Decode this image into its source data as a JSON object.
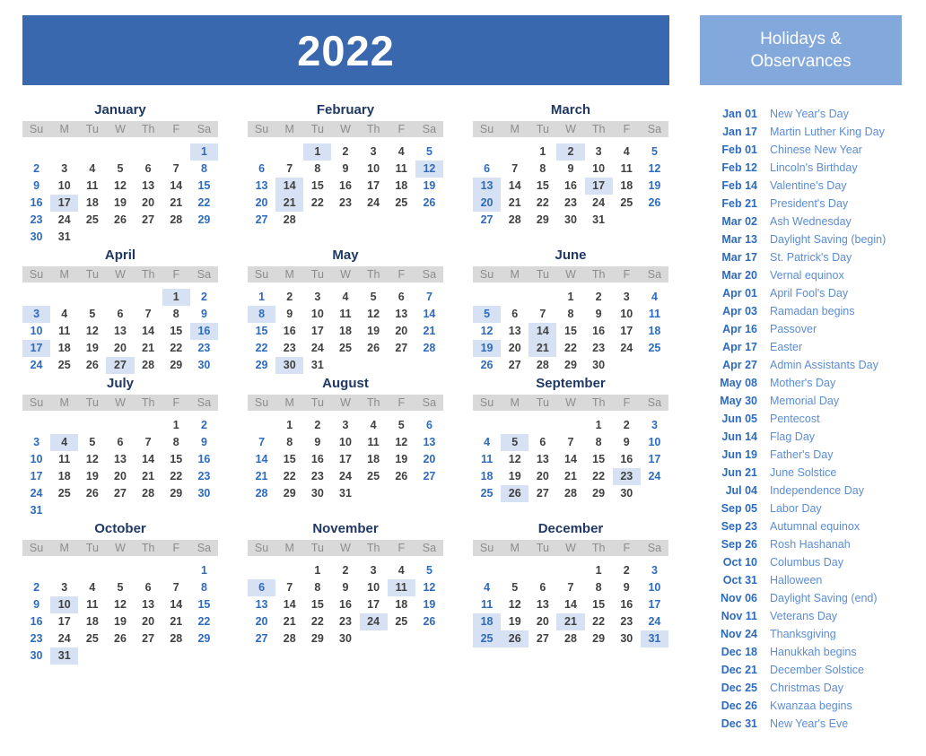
{
  "year_banner": {
    "year": "2022"
  },
  "holidays_panel": {
    "title_line1": "Holidays &",
    "title_line2": "Observances",
    "items": [
      {
        "date": "Jan 01",
        "name": "New Year's Day"
      },
      {
        "date": "Jan 17",
        "name": "Martin Luther King Day"
      },
      {
        "date": "Feb 01",
        "name": "Chinese New Year"
      },
      {
        "date": "Feb 12",
        "name": "Lincoln's Birthday"
      },
      {
        "date": "Feb 14",
        "name": "Valentine's Day"
      },
      {
        "date": "Feb 21",
        "name": "President's Day"
      },
      {
        "date": "Mar 02",
        "name": "Ash Wednesday"
      },
      {
        "date": "Mar 13",
        "name": "Daylight Saving (begin)"
      },
      {
        "date": "Mar 17",
        "name": "St. Patrick's Day"
      },
      {
        "date": "Mar 20",
        "name": "Vernal equinox"
      },
      {
        "date": "Apr 01",
        "name": "April Fool's Day"
      },
      {
        "date": "Apr 03",
        "name": "Ramadan begins"
      },
      {
        "date": "Apr 16",
        "name": "Passover"
      },
      {
        "date": "Apr 17",
        "name": "Easter"
      },
      {
        "date": "Apr 27",
        "name": "Admin Assistants Day"
      },
      {
        "date": "May 08",
        "name": "Mother's Day"
      },
      {
        "date": "May 30",
        "name": "Memorial Day"
      },
      {
        "date": "Jun 05",
        "name": "Pentecost"
      },
      {
        "date": "Jun 14",
        "name": "Flag Day"
      },
      {
        "date": "Jun 19",
        "name": "Father's Day"
      },
      {
        "date": "Jun 21",
        "name": "June Solstice"
      },
      {
        "date": "Jul 04",
        "name": "Independence Day"
      },
      {
        "date": "Sep 05",
        "name": "Labor Day"
      },
      {
        "date": "Sep 23",
        "name": "Autumnal equinox"
      },
      {
        "date": "Sep 26",
        "name": "Rosh Hashanah"
      },
      {
        "date": "Oct 10",
        "name": "Columbus Day"
      },
      {
        "date": "Oct 31",
        "name": "Halloween"
      },
      {
        "date": "Nov 06",
        "name": "Daylight Saving (end)"
      },
      {
        "date": "Nov 11",
        "name": "Veterans Day"
      },
      {
        "date": "Nov 24",
        "name": "Thanksgiving"
      },
      {
        "date": "Dec 18",
        "name": "Hanukkah begins"
      },
      {
        "date": "Dec 21",
        "name": "December Solstice"
      },
      {
        "date": "Dec 25",
        "name": "Christmas Day"
      },
      {
        "date": "Dec 26",
        "name": "Kwanzaa begins"
      },
      {
        "date": "Dec 31",
        "name": "New Year's Eve"
      }
    ]
  },
  "calendar": {
    "weekday_headers": [
      "Su",
      "M",
      "Tu",
      "W",
      "Th",
      "F",
      "Sa"
    ],
    "weekend_columns": [
      0,
      6
    ],
    "months": [
      {
        "name": "January",
        "days": 31,
        "first_weekday": 6,
        "highlights": [
          1,
          17
        ]
      },
      {
        "name": "February",
        "days": 28,
        "first_weekday": 2,
        "highlights": [
          1,
          12,
          14,
          21
        ]
      },
      {
        "name": "March",
        "days": 31,
        "first_weekday": 2,
        "highlights": [
          2,
          13,
          17,
          20
        ]
      },
      {
        "name": "April",
        "days": 30,
        "first_weekday": 5,
        "highlights": [
          1,
          3,
          16,
          17,
          27
        ]
      },
      {
        "name": "May",
        "days": 31,
        "first_weekday": 0,
        "highlights": [
          8,
          30
        ]
      },
      {
        "name": "June",
        "days": 30,
        "first_weekday": 3,
        "highlights": [
          5,
          14,
          19,
          21
        ]
      },
      {
        "name": "July",
        "days": 31,
        "first_weekday": 5,
        "highlights": [
          4
        ]
      },
      {
        "name": "August",
        "days": 31,
        "first_weekday": 1,
        "highlights": []
      },
      {
        "name": "September",
        "days": 30,
        "first_weekday": 4,
        "highlights": [
          5,
          23,
          26
        ]
      },
      {
        "name": "October",
        "days": 31,
        "first_weekday": 6,
        "highlights": [
          10,
          31
        ]
      },
      {
        "name": "November",
        "days": 30,
        "first_weekday": 2,
        "highlights": [
          6,
          11,
          24
        ]
      },
      {
        "name": "December",
        "days": 31,
        "first_weekday": 4,
        "highlights": [
          18,
          21,
          25,
          26,
          31
        ]
      }
    ]
  },
  "colors": {
    "banner_blue": "#3a68ae",
    "panel_blue": "#83a8dc",
    "month_title": "#1f3864",
    "weekday_header_bg": "#d9d9d9",
    "weekday_header_text": "#8c8c8c",
    "weekday_number": "#404040",
    "weekend_number": "#2e6bbd",
    "holiday_highlight_bg": "#d6e2f3",
    "holiday_name_text": "#5b8dd4"
  }
}
